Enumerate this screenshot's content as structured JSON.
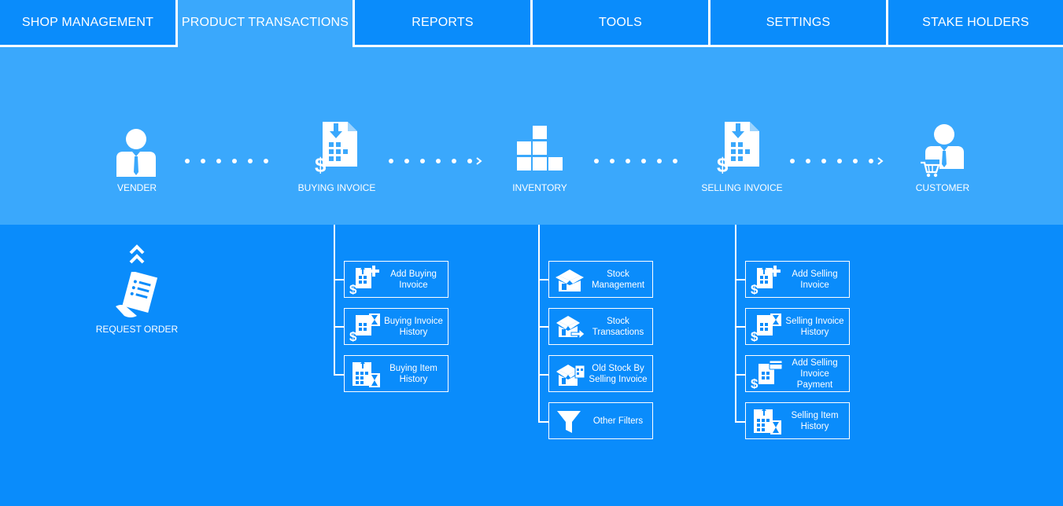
{
  "tabs": [
    {
      "label": "SHOP MANAGEMENT"
    },
    {
      "label": "PRODUCT TRANSACTIONS"
    },
    {
      "label": "REPORTS"
    },
    {
      "label": "TOOLS"
    },
    {
      "label": "SETTINGS"
    },
    {
      "label": "STAKE HOLDERS"
    }
  ],
  "flow": {
    "vender": "VENDER",
    "buying_invoice": "BUYING INVOICE",
    "inventory": "INVENTORY",
    "selling_invoice": "SELLING INVOICE",
    "customer": "CUSTOMER"
  },
  "request_order": "REQUEST ORDER",
  "buying": [
    {
      "label": "Add Buying\nInvoice"
    },
    {
      "label": "Buying Invoice\nHistory"
    },
    {
      "label": "Buying Item\nHistory"
    }
  ],
  "inventory": [
    {
      "label": "Stock\nManagement"
    },
    {
      "label": "Stock\nTransactions"
    },
    {
      "label": "Old Stock By\nSelling Invoice"
    },
    {
      "label": "Other Filters"
    }
  ],
  "selling": [
    {
      "label": "Add Selling\nInvoice"
    },
    {
      "label": "Selling Invoice\nHistory"
    },
    {
      "label": "Add Selling\nInvoice\nPayment"
    },
    {
      "label": "Selling Item\nHistory"
    }
  ],
  "colors": {
    "background": "#0a8cfb",
    "band": "#3aa8fc",
    "foreground": "#ffffff"
  }
}
